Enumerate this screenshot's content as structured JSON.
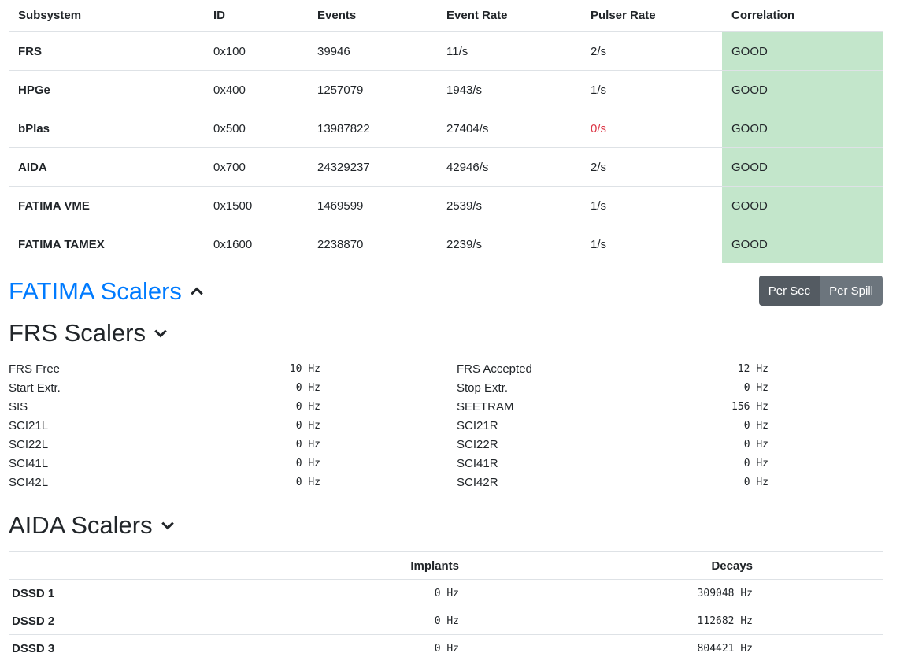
{
  "subsystems": {
    "headers": [
      "Subsystem",
      "ID",
      "Events",
      "Event Rate",
      "Pulser Rate",
      "Correlation"
    ],
    "rows": [
      {
        "name": "FRS",
        "id": "0x100",
        "events": "39946",
        "rate": "11/s",
        "pulser": "2/s",
        "corr": "GOOD"
      },
      {
        "name": "HPGe",
        "id": "0x400",
        "events": "1257079",
        "rate": "1943/s",
        "pulser": "1/s",
        "corr": "GOOD"
      },
      {
        "name": "bPlas",
        "id": "0x500",
        "events": "13987822",
        "rate": "27404/s",
        "pulser": "0/s",
        "corr": "GOOD"
      },
      {
        "name": "AIDA",
        "id": "0x700",
        "events": "24329237",
        "rate": "42946/s",
        "pulser": "2/s",
        "corr": "GOOD"
      },
      {
        "name": "FATIMA VME",
        "id": "0x1500",
        "events": "1469599",
        "rate": "2539/s",
        "pulser": "1/s",
        "corr": "GOOD"
      },
      {
        "name": "FATIMA TAMEX",
        "id": "0x1600",
        "events": "2238870",
        "rate": "2239/s",
        "pulser": "1/s",
        "corr": "GOOD"
      }
    ]
  },
  "fatima": {
    "title": "FATIMA Scalers",
    "per_sec": "Per Sec",
    "per_spill": "Per Spill"
  },
  "frs": {
    "title": "FRS Scalers",
    "left": [
      [
        "FRS Free",
        "10 Hz"
      ],
      [
        "Start Extr.",
        "0 Hz"
      ],
      [
        "SIS",
        "0 Hz"
      ],
      [
        "SCI21L",
        "0 Hz"
      ],
      [
        "SCI22L",
        "0 Hz"
      ],
      [
        "SCI41L",
        "0 Hz"
      ],
      [
        "SCI42L",
        "0 Hz"
      ]
    ],
    "right": [
      [
        "FRS Accepted",
        "12 Hz"
      ],
      [
        "Stop Extr.",
        "0 Hz"
      ],
      [
        "SEETRAM",
        "156 Hz"
      ],
      [
        "SCI21R",
        "0 Hz"
      ],
      [
        "SCI22R",
        "0 Hz"
      ],
      [
        "SCI41R",
        "0 Hz"
      ],
      [
        "SCI42R",
        "0 Hz"
      ]
    ]
  },
  "aida": {
    "title": "AIDA Scalers",
    "headers": [
      "",
      "Implants",
      "Decays"
    ],
    "rows": [
      [
        "DSSD 1",
        "0 Hz",
        "309048 Hz"
      ],
      [
        "DSSD 2",
        "0 Hz",
        "112682 Hz"
      ],
      [
        "DSSD 3",
        "0 Hz",
        "804421 Hz"
      ]
    ]
  }
}
